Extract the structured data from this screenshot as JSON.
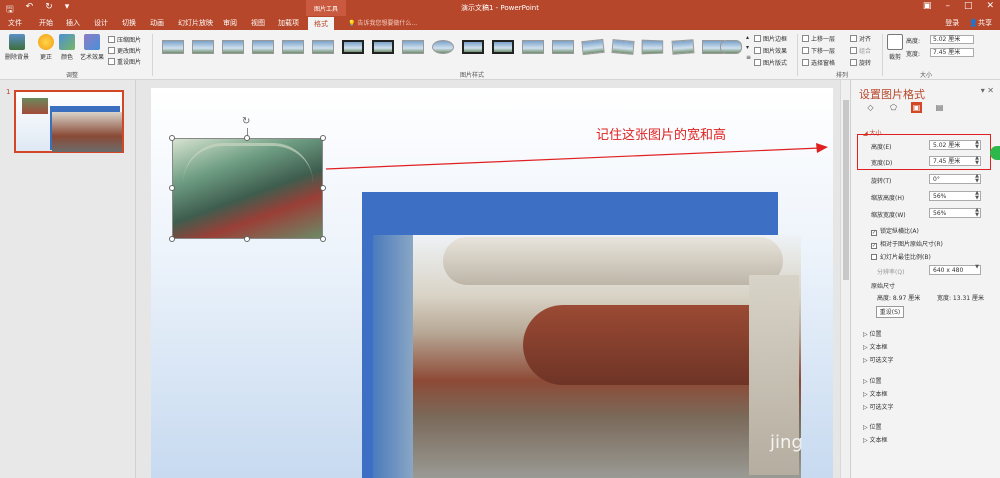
{
  "titlebar": {
    "title": "演示文稿1 - PowerPoint",
    "context_tab_group": "图片工具"
  },
  "tabs": [
    {
      "label": "文件"
    },
    {
      "label": "开始"
    },
    {
      "label": "插入"
    },
    {
      "label": "设计"
    },
    {
      "label": "切换"
    },
    {
      "label": "动画"
    },
    {
      "label": "幻灯片放映"
    },
    {
      "label": "审阅"
    },
    {
      "label": "视图"
    },
    {
      "label": "加载项"
    },
    {
      "label": "格式"
    }
  ],
  "tell_me": "告诉我您想要做什么...",
  "account": {
    "login": "登录",
    "share": "共享"
  },
  "ribbon": {
    "adjust": {
      "remove_bg": "删除背景",
      "corrections": "更正",
      "color": "颜色",
      "artistic": "艺术效果",
      "compress": "压缩图片",
      "change": "更改图片",
      "reset": "重设图片",
      "group_label": "调整"
    },
    "styles": {
      "group_label": "图片样式"
    },
    "style_opts": {
      "border": "图片边框",
      "effects": "图片效果",
      "layout": "图片版式"
    },
    "arrange": {
      "forward": "上移一层",
      "backward": "下移一层",
      "selection_pane": "选择窗格",
      "align": "对齐",
      "group": "组合",
      "rotate": "旋转",
      "group_label": "排列"
    },
    "size": {
      "crop": "裁剪",
      "height_label": "高度:",
      "height_value": "5.02 厘米",
      "width_label": "宽度:",
      "width_value": "7.45 厘米",
      "group_label": "大小"
    }
  },
  "slide": {
    "number": "1",
    "annotation": "记住这张图片的宽和高",
    "watermark": "jing"
  },
  "format_pane": {
    "title": "设置图片格式",
    "section_size": "大小",
    "height_label": "高度(E)",
    "height_value": "5.02 厘米",
    "width_label": "宽度(D)",
    "width_value": "7.45 厘米",
    "rotation_label": "旋转(T)",
    "rotation_value": "0°",
    "scale_h_label": "缩放高度(H)",
    "scale_h_value": "56%",
    "scale_w_label": "缩放宽度(W)",
    "scale_w_value": "56%",
    "lock_aspect": "锁定纵横比(A)",
    "relative_original": "相对于图片原始尺寸(R)",
    "best_scale": "幻灯片最佳比例(B)",
    "resolution_label": "分辨率(Q)",
    "resolution_value": "640 x 480",
    "original_size": "原始尺寸",
    "original_height": "高度:  8.97 厘米",
    "original_width": "宽度:  13.31 厘米",
    "reset_button": "重设(S)",
    "sections": [
      "位置",
      "文本框",
      "可选文字",
      "位置",
      "文本框",
      "可选文字",
      "位置",
      "文本框"
    ]
  },
  "colors": {
    "accent": "#b7472a",
    "highlight": "#e02020"
  }
}
